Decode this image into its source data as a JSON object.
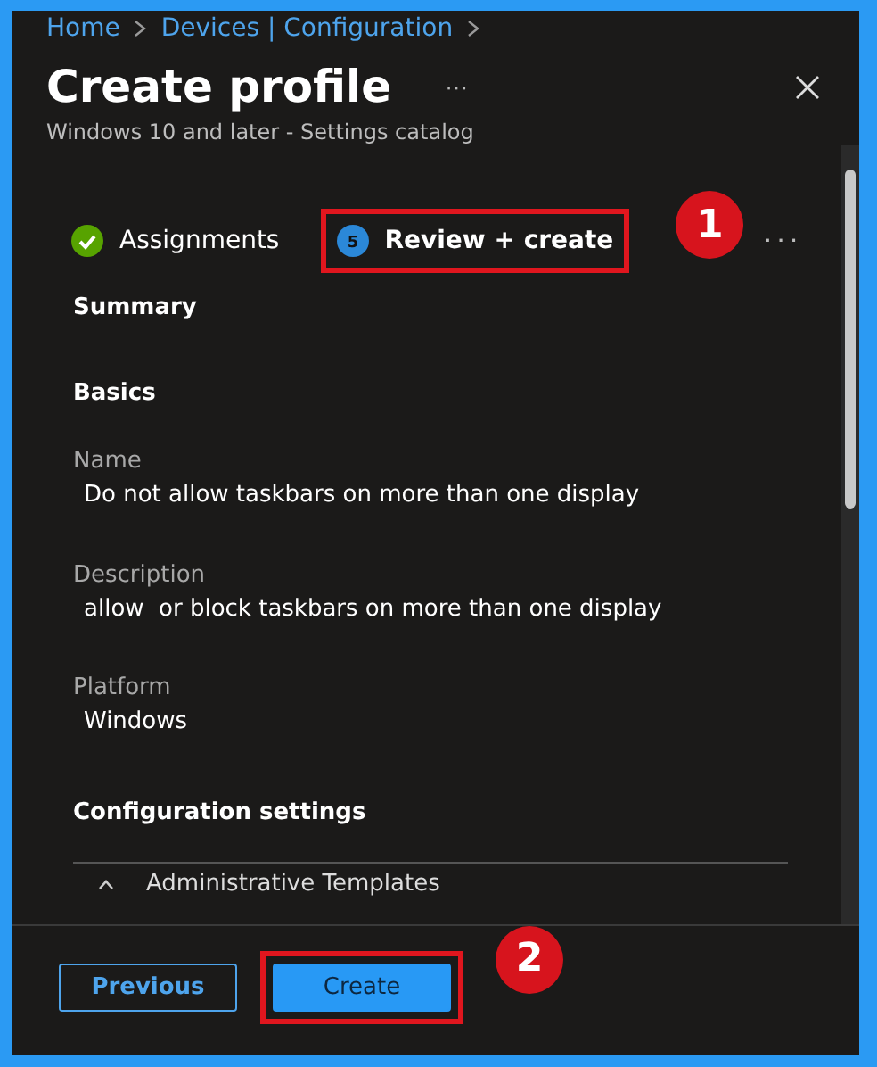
{
  "breadcrumb": [
    "Home",
    "Devices | Configuration"
  ],
  "header": {
    "title": "Create profile",
    "more": "···",
    "subtitle": "Windows 10 and later - Settings catalog"
  },
  "steps": [
    {
      "label": "Assignments",
      "kind": "done",
      "selected": false,
      "highlighted": false
    },
    {
      "label": "Review + create",
      "kind": "number",
      "number": "5",
      "selected": true,
      "highlighted": true,
      "callout": "1"
    }
  ],
  "steps_more": "···",
  "summary": {
    "heading": "Summary",
    "section": "Basics",
    "fields": [
      {
        "label": "Name",
        "value": "Do not allow taskbars on more than one display"
      },
      {
        "label": "Description",
        "value": "allow  or block taskbars on more than one display"
      },
      {
        "label": "Platform",
        "value": "Windows"
      }
    ],
    "config_heading": "Configuration settings",
    "config_item": "Administrative Templates"
  },
  "footer": {
    "buttons": [
      {
        "label": "Previous",
        "kind": "secondary",
        "highlighted": false
      },
      {
        "label": "Create",
        "kind": "primary",
        "highlighted": true,
        "callout": "2"
      }
    ]
  }
}
